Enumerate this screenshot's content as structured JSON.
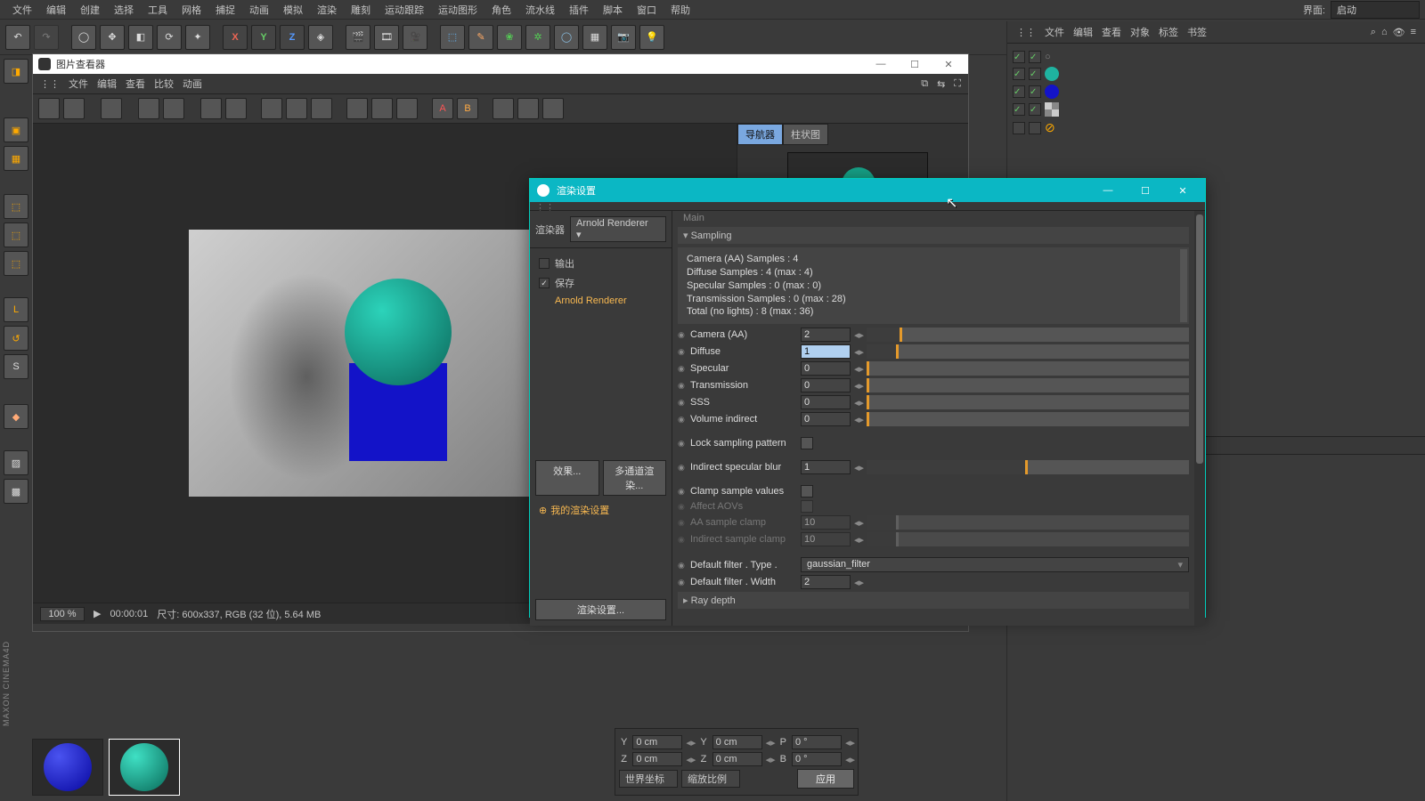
{
  "menubar": {
    "items": [
      "文件",
      "编辑",
      "创建",
      "选择",
      "工具",
      "网格",
      "捕捉",
      "动画",
      "模拟",
      "渲染",
      "雕刻",
      "运动跟踪",
      "运动图形",
      "角色",
      "流水线",
      "插件",
      "脚本",
      "窗口",
      "帮助"
    ],
    "iface_label": "界面:",
    "iface_value": "启动"
  },
  "right_panel_tabs": [
    "文件",
    "编辑",
    "查看",
    "对象",
    "标签",
    "书签"
  ],
  "pic_viewer": {
    "title": "图片查看器",
    "menu": [
      "文件",
      "编辑",
      "查看",
      "比较",
      "动画"
    ],
    "side_tabs": [
      "导航器",
      "柱状图"
    ],
    "zoom": "100 %",
    "time": "00:00:01",
    "size": "尺寸: 600x337, RGB (32 位), 5.64 MB"
  },
  "coord": {
    "Y": "0 cm",
    "Y2": "0 cm",
    "P": "0 °",
    "Z": "0 cm",
    "Z2": "0 cm",
    "B": "0 °",
    "sys": "世界坐标",
    "scalem": "缩放比例",
    "apply": "应用"
  },
  "dialog": {
    "title": "渲染设置",
    "renderer_label": "渲染器",
    "renderer_value": "Arnold Renderer",
    "left_items": [
      "输出",
      "保存",
      "Arnold Renderer"
    ],
    "left_checked": [
      false,
      true,
      false
    ],
    "left_active_index": 2,
    "effect_btn": "效果...",
    "multi_btn": "多通道渲染...",
    "mysetting": "我的渲染设置",
    "render_settings_btn": "渲染设置...",
    "main_header": "Main",
    "sampling_header": "Sampling",
    "info": [
      "Camera (AA) Samples : 4",
      "Diffuse Samples : 4 (max : 4)",
      "Specular Samples : 0 (max : 0)",
      "Transmission Samples : 0 (max : 28)",
      "Total (no lights) : 8 (max : 36)"
    ],
    "fields": {
      "camera_aa": {
        "label": "Camera (AA)",
        "value": "2",
        "barPct": 11
      },
      "diffuse": {
        "label": "Diffuse",
        "value": "1",
        "barPct": 10,
        "selected": true
      },
      "specular": {
        "label": "Specular",
        "value": "0",
        "barPct": 0
      },
      "transmission": {
        "label": "Transmission",
        "value": "0",
        "barPct": 0
      },
      "sss": {
        "label": "SSS",
        "value": "0",
        "barPct": 0
      },
      "vol": {
        "label": "Volume indirect",
        "value": "0",
        "barPct": 0
      },
      "lock": {
        "label": "Lock sampling pattern",
        "checked": false
      },
      "isblur": {
        "label": "Indirect specular blur",
        "value": "1",
        "barPct": 50
      },
      "clamp": {
        "label": "Clamp sample values",
        "checked": false
      },
      "aov": {
        "label": "Affect AOVs",
        "checked": false,
        "disabled": true
      },
      "aaclamp": {
        "label": "AA sample clamp",
        "value": "10",
        "barPct": 10,
        "disabled": true
      },
      "indclamp": {
        "label": "Indirect sample clamp",
        "value": "10",
        "barPct": 10,
        "disabled": true
      },
      "filtertype": {
        "label": "Default filter . Type .",
        "value": "gaussian_filter"
      },
      "filterw": {
        "label": "Default filter . Width",
        "value": "2"
      },
      "raydepth": "Ray depth"
    }
  }
}
